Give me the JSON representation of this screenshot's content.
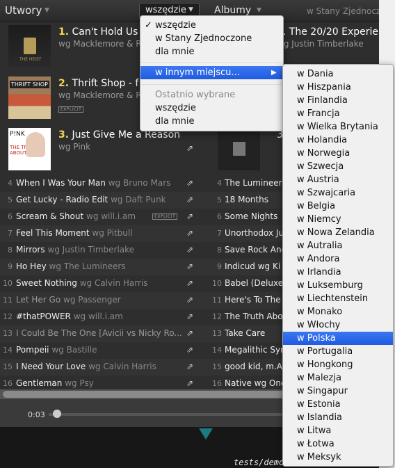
{
  "header": {
    "tracks_tab": "Utwory",
    "location_select": "wszędzie",
    "albums_tab": "Albumy",
    "right_location": "w Stany Zjednoczone"
  },
  "top_tracks": [
    {
      "rank": "1.",
      "title": "Can't Hold Us - f",
      "artist": "wg Macklemore & Ry"
    },
    {
      "rank": "2.",
      "title": "Thrift Shop - f",
      "artist": "wg Macklemore & Ry",
      "explicit": "EXPLICIT"
    },
    {
      "rank": "3.",
      "title": "Just Give Me a Reason",
      "artist": "wg Pink"
    }
  ],
  "cover_texts": {
    "cover1": "THE HEIST",
    "cover2": "THRIFT SHOP",
    "cover3_artist": "P!NK",
    "cover3_title": "THE TRUTH ABOUT LOVE"
  },
  "top_albums": [
    {
      "title": "1. The 20/20 Experie",
      "artist": "wg Justin Timberlake"
    },
    {
      "title": "2.",
      "artist": ""
    },
    {
      "title": "3.",
      "artist": ""
    }
  ],
  "track_rows": [
    {
      "n": "4",
      "title": "When I Was Your Man",
      "by": "wg Bruno Mars"
    },
    {
      "n": "5",
      "title": "Get Lucky - Radio Edit",
      "by": "wg Daft Punk"
    },
    {
      "n": "6",
      "title": "Scream & Shout",
      "by": "wg will.i.am",
      "explicit": "EXPLICIT"
    },
    {
      "n": "7",
      "title": "Feel This Moment",
      "by": "wg Pitbull"
    },
    {
      "n": "8",
      "title": "Mirrors",
      "by": "wg Justin Timberlake"
    },
    {
      "n": "9",
      "title": "Ho Hey",
      "by": "wg The Lumineers"
    },
    {
      "n": "10",
      "title": "Sweet Nothing",
      "by": "wg Calvin Harris"
    },
    {
      "n": "11",
      "title": "Let Her Go",
      "by": "wg Passenger",
      "dim": true
    },
    {
      "n": "12",
      "title": "#thatPOWER",
      "by": "wg will.i.am"
    },
    {
      "n": "13",
      "title": "I Could Be The One [Avicii vs Nicky Ro...",
      "by": "",
      "dim": true
    },
    {
      "n": "14",
      "title": "Pompeii",
      "by": "wg Bastille"
    },
    {
      "n": "15",
      "title": "I Need Your Love",
      "by": "wg Calvin Harris"
    },
    {
      "n": "16",
      "title": "Gentleman",
      "by": "wg Psy"
    }
  ],
  "album_rows": [
    {
      "n": "4",
      "title": "The Lumineers"
    },
    {
      "n": "5",
      "title": "18 Months"
    },
    {
      "n": "6",
      "title": "Some Nights"
    },
    {
      "n": "7",
      "title": "Unorthodox Ju"
    },
    {
      "n": "8",
      "title": "Save Rock And"
    },
    {
      "n": "9",
      "title": "Indicud  wg Ki"
    },
    {
      "n": "10",
      "title": "Babel (Deluxe"
    },
    {
      "n": "11",
      "title": "Here's To The"
    },
    {
      "n": "12",
      "title": "The Truth Abo"
    },
    {
      "n": "13",
      "title": "Take Care"
    },
    {
      "n": "14",
      "title": "Megalithic Sym"
    },
    {
      "n": "15",
      "title": "good kid, m.A."
    },
    {
      "n": "16",
      "title": "Native  wg One"
    }
  ],
  "player": {
    "time": "0:03"
  },
  "terminal_text": "tests/demo/",
  "dropdown": {
    "items": [
      "wszędzie",
      "w Stany Zjednoczone",
      "dla mnie"
    ],
    "checked_mark": "✓",
    "other_location": "w innym miejscu...",
    "submenu_arrow": "▶",
    "recent_header": "Ostatnio wybrane",
    "recent": [
      "wszędzie",
      "dla mnie"
    ]
  },
  "countries": [
    "w Dania",
    "w Hiszpania",
    "w Finlandia",
    "w Francja",
    "w Wielka Brytania",
    "w Holandia",
    "w Norwegia",
    "w Szwecja",
    "w Austria",
    "w Szwajcaria",
    "w Belgia",
    "w Niemcy",
    "w Nowa Zelandia",
    "w Autralia",
    "w Andora",
    "w Irlandia",
    "w Luksemburg",
    "w Liechtenstein",
    "w Monako",
    "w Włochy",
    "w Polska",
    "w Portugalia",
    "w Hongkong",
    "w Malezja",
    "w Singapur",
    "w Estonia",
    "w Islandia",
    "w Litwa",
    "w Łotwa",
    "w Meksyk"
  ],
  "selected_country": "w Polska",
  "icons": {
    "share": "share-icon",
    "caret": "caret-down-icon"
  }
}
